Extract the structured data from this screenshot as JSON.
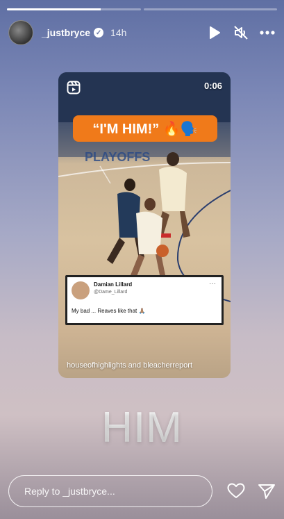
{
  "story": {
    "progress_segments": [
      1.0,
      0.0
    ],
    "username": "_justbryce",
    "time_ago": "14h",
    "verified_mark": "✓",
    "icons": [
      "play-icon",
      "muted-icon",
      "more-icon"
    ]
  },
  "reel": {
    "duration": "0:06",
    "banner_text": "“I'M HIM!” 🔥🗣️",
    "tweet": {
      "name": "Damian Lillard",
      "handle": "@Dame_Lillard",
      "body": "My bad ... Reaves like that 🙏🏽",
      "more": "···"
    },
    "credit": "houseofhighlights and bleacherreport"
  },
  "overlay_text": "HIM",
  "reply": {
    "placeholder": "Reply to _justbryce..."
  },
  "colors": {
    "banner": "#f07a1a",
    "bg_top": "#5f6fa3",
    "bg_bottom": "#cfc0c4"
  }
}
